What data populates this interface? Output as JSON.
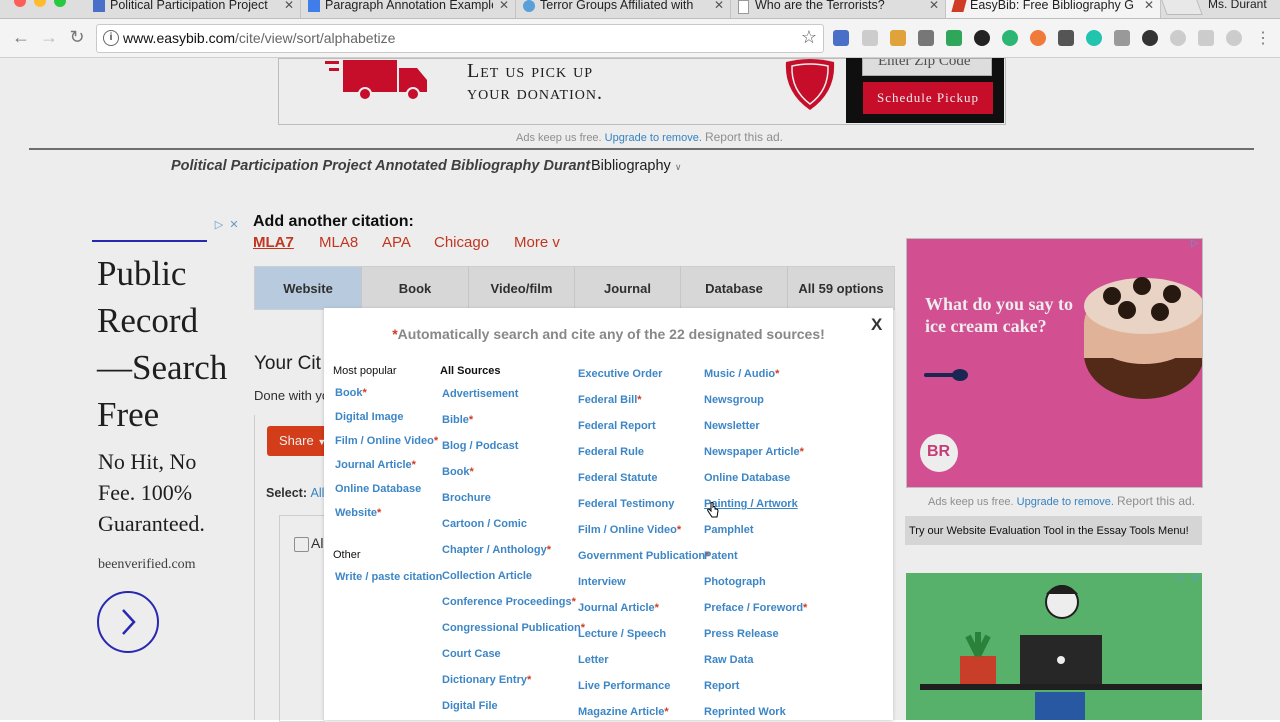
{
  "browser": {
    "tabs": [
      {
        "title": "Political Participation Project",
        "favicon_color": "#4a6fc9",
        "active": false
      },
      {
        "title": "Paragraph Annotation Example",
        "favicon_color": "#3f7de8",
        "active": false
      },
      {
        "title": "Terror Groups Affiliated with",
        "favicon_color": "#5aa0d8",
        "active": false
      },
      {
        "title": "Who are the Terrorists?",
        "favicon_color": "#999999",
        "active": false
      },
      {
        "title": "EasyBib: Free Bibliography G",
        "favicon_color": "#d03b24",
        "active": true
      }
    ],
    "profile_name": "Ms. Durant",
    "url_host": "www.easybib.com",
    "url_path": "/cite/view/sort/alphabetize"
  },
  "top_ad": {
    "headline_line1": "Let us pick up",
    "headline_line2": "your donation.",
    "zip_placeholder": "Enter Zip Code",
    "button_label": "Schedule Pickup"
  },
  "ads_note": {
    "prefix": "Ads keep us free.",
    "link": "Upgrade to remove.",
    "report": "Report this ad."
  },
  "project": {
    "title": "Political Participation Project Annotated Bibliography Durant",
    "dropdown_label": "Bibliography"
  },
  "left_ad": {
    "title": "Public Record —Search Free",
    "subtitle": "No Hit, No Fee. 100% Guaranteed.",
    "url": "beenverified.com"
  },
  "citation": {
    "heading": "Add another citation:",
    "styles": [
      "MLA7",
      "MLA8",
      "APA",
      "Chicago",
      "More v"
    ],
    "source_tabs": [
      "Website",
      "Book",
      "Video/film",
      "Journal",
      "Database",
      "All 59 options"
    ],
    "your_citations": "Your Cit",
    "done_with": "Done with yo",
    "share_label": "Share",
    "select_label": "Select:",
    "select_all": "All",
    "all_row_text": "Al"
  },
  "modal": {
    "close": "X",
    "header_star": "*",
    "header": "Automatically search and cite any of the 22 designated sources!",
    "popular_heading": "Most popular",
    "popular": [
      {
        "label": "Book",
        "req": true
      },
      {
        "label": "Digital Image",
        "req": false
      },
      {
        "label": "Film / Online Video",
        "req": true
      },
      {
        "label": "Journal Article",
        "req": true
      },
      {
        "label": "Online Database",
        "req": false
      },
      {
        "label": "Website",
        "req": true
      }
    ],
    "other_heading": "Other",
    "other": [
      {
        "label": "Write / paste citation",
        "req": false
      }
    ],
    "all_heading": "All Sources",
    "col1": [
      {
        "label": "Advertisement",
        "req": false
      },
      {
        "label": "Bible",
        "req": true
      },
      {
        "label": "Blog / Podcast",
        "req": false
      },
      {
        "label": "Book",
        "req": true
      },
      {
        "label": "Brochure",
        "req": false
      },
      {
        "label": "Cartoon / Comic",
        "req": false
      },
      {
        "label": "Chapter / Anthology",
        "req": true
      },
      {
        "label": "Collection Article",
        "req": false
      },
      {
        "label": "Conference Proceedings",
        "req": true
      },
      {
        "label": "Congressional Publication",
        "req": true
      },
      {
        "label": "Court Case",
        "req": false
      },
      {
        "label": "Dictionary Entry",
        "req": true
      },
      {
        "label": "Digital File",
        "req": false
      }
    ],
    "col2": [
      {
        "label": "Executive Order",
        "req": false
      },
      {
        "label": "Federal Bill",
        "req": true
      },
      {
        "label": "Federal Report",
        "req": false
      },
      {
        "label": "Federal Rule",
        "req": false
      },
      {
        "label": "Federal Statute",
        "req": false
      },
      {
        "label": "Federal Testimony",
        "req": false
      },
      {
        "label": "Film / Online Video",
        "req": true
      },
      {
        "label": "Government Publication",
        "req": true
      },
      {
        "label": "Interview",
        "req": false
      },
      {
        "label": "Journal Article",
        "req": true
      },
      {
        "label": "Lecture / Speech",
        "req": false
      },
      {
        "label": "Letter",
        "req": false
      },
      {
        "label": "Live Performance",
        "req": false
      },
      {
        "label": "Magazine Article",
        "req": true
      }
    ],
    "col3": [
      {
        "label": "Music / Audio",
        "req": true
      },
      {
        "label": "Newsgroup",
        "req": false
      },
      {
        "label": "Newsletter",
        "req": false
      },
      {
        "label": "Newspaper Article",
        "req": true
      },
      {
        "label": "Online Database",
        "req": false
      },
      {
        "label": "Painting / Artwork",
        "req": false,
        "hover": true
      },
      {
        "label": "Pamphlet",
        "req": false
      },
      {
        "label": "Patent",
        "req": false
      },
      {
        "label": "Photograph",
        "req": false
      },
      {
        "label": "Preface / Foreword",
        "req": true
      },
      {
        "label": "Press Release",
        "req": false
      },
      {
        "label": "Raw Data",
        "req": false
      },
      {
        "label": "Report",
        "req": false
      },
      {
        "label": "Reprinted Work",
        "req": false
      }
    ]
  },
  "right_ad": {
    "text": "What do you say to ice cream cake?",
    "logo": "BR",
    "eval_tool": "Try our Website Evaluation Tool in the Essay Tools Menu!"
  },
  "icons": [
    "close-icon",
    "back-icon",
    "forward-icon",
    "reload-icon",
    "info-icon",
    "star-icon",
    "menu-icon",
    "cursor-icon"
  ],
  "colors": {
    "brand_red": "#d03b24",
    "link_blue": "#3d86c6",
    "active_tab": "#c6dbef",
    "ad_pink": "#e2559e",
    "ad_green": "#5fbf73"
  }
}
